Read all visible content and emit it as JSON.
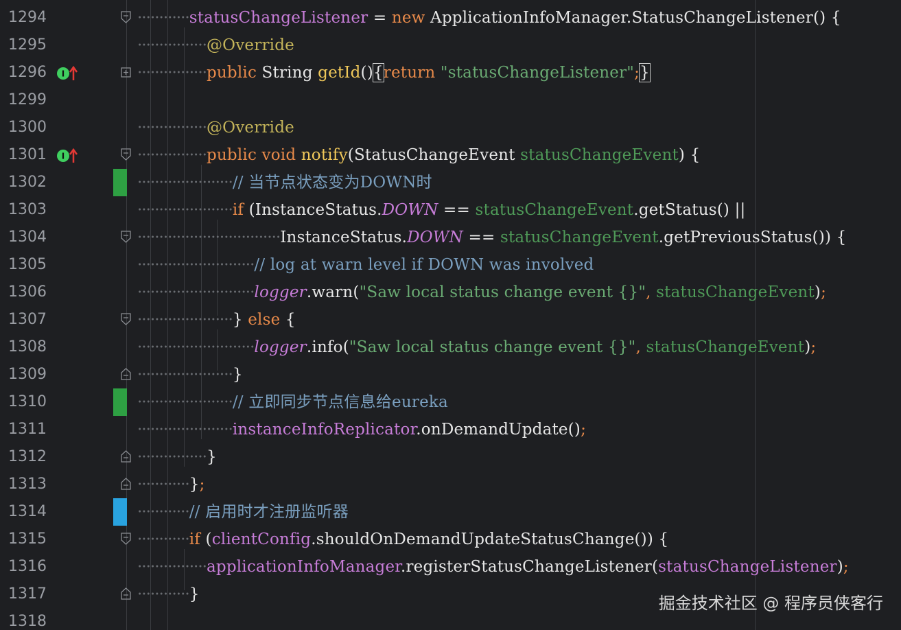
{
  "editor": {
    "watermark": "掘金技术社区 @ 程序员侠客行",
    "lines": [
      {
        "num": "1294"
      },
      {
        "num": "1295"
      },
      {
        "num": "1296"
      },
      {
        "num": "1299"
      },
      {
        "num": "1300"
      },
      {
        "num": "1301"
      },
      {
        "num": "1302"
      },
      {
        "num": "1303"
      },
      {
        "num": "1304"
      },
      {
        "num": "1305"
      },
      {
        "num": "1306"
      },
      {
        "num": "1307"
      },
      {
        "num": "1308"
      },
      {
        "num": "1309"
      },
      {
        "num": "1310"
      },
      {
        "num": "1311"
      },
      {
        "num": "1312"
      },
      {
        "num": "1313"
      },
      {
        "num": "1314"
      },
      {
        "num": "1315"
      },
      {
        "num": "1316"
      },
      {
        "num": "1317"
      },
      {
        "num": "1318"
      }
    ],
    "code": {
      "l1294": {
        "a": "statusChangeListener",
        "b": " = ",
        "c": "new",
        "d": " ApplicationInfoManager.StatusChangeListener() {"
      },
      "l1295": {
        "a": "@Override"
      },
      "l1296": {
        "a": "public",
        "b": " String ",
        "c": "getId",
        "d": "()",
        "e": "{",
        "f": "return",
        "g": " \"statusChangeListener\"",
        "h": ";",
        "i": "}"
      },
      "l1300": {
        "a": "@Override"
      },
      "l1301": {
        "a": "public void",
        "b": " notify",
        "c": "(StatusChangeEvent ",
        "d": "statusChangeEvent",
        "e": ") {"
      },
      "l1302": {
        "a": "// 当节点状态变为DOWN时"
      },
      "l1303": {
        "a": "if",
        "b": " (InstanceStatus.",
        "c": "DOWN",
        "d": " == ",
        "e": "statusChangeEvent",
        "f": ".getStatus() ||"
      },
      "l1304": {
        "a": "InstanceStatus.",
        "b": "DOWN",
        "c": " == ",
        "d": "statusChangeEvent",
        "e": ".getPreviousStatus()) {"
      },
      "l1305": {
        "a": "// log at warn level if DOWN was involved"
      },
      "l1306": {
        "a": "logger",
        "b": ".warn(",
        "c": "\"Saw local status change event {}\"",
        "d": ",",
        "e": " statusChangeEvent",
        "f": ")",
        "g": ";"
      },
      "l1307": {
        "a": "} ",
        "b": "else",
        "c": " {"
      },
      "l1308": {
        "a": "logger",
        "b": ".info(",
        "c": "\"Saw local status change event {}\"",
        "d": ",",
        "e": " statusChangeEvent",
        "f": ")",
        "g": ";"
      },
      "l1309": {
        "a": "}"
      },
      "l1310": {
        "a": "// 立即同步节点信息给eureka"
      },
      "l1311": {
        "a": "instanceInfoReplicator",
        "b": ".onDemandUpdate()",
        "c": ";"
      },
      "l1312": {
        "a": "}"
      },
      "l1313": {
        "a": "}",
        "b": ";"
      },
      "l1314": {
        "a": "// 启用时才注册监听器"
      },
      "l1315": {
        "a": "if",
        "b": " (",
        "c": "clientConfig",
        "d": ".shouldOnDemandUpdateStatusChange()) {"
      },
      "l1316": {
        "a": "applicationInfoManager",
        "b": ".registerStatusChangeListener(",
        "c": "statusChangeListener",
        "d": ")",
        "e": ";"
      },
      "l1317": {
        "a": "}"
      }
    },
    "colors": {
      "background": "#1e1f22",
      "keyword": "#e88a4a",
      "string": "#6aab73",
      "field": "#c77dd8",
      "comment": "#7a9fbf",
      "change_modified": "#2ea043",
      "change_added": "#29a3e0"
    },
    "gutter_icons": [
      "implementing-method-icon",
      "implementing-method-icon"
    ]
  }
}
